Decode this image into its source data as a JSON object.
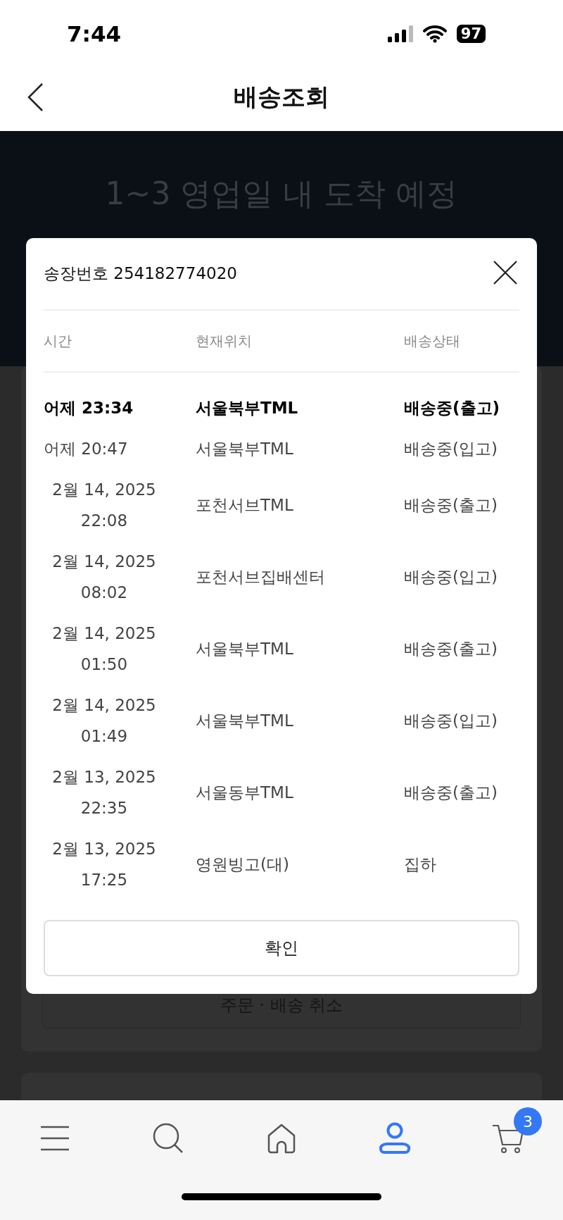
{
  "status_bar": {
    "time": "7:44",
    "battery": "97"
  },
  "header": {
    "title": "배송조회"
  },
  "banner": {
    "text": "1~3 영업일 내 도착 예정"
  },
  "background_button": {
    "label": "주문 · 배송 취소"
  },
  "modal": {
    "title": "송장번호 254182774020",
    "columns": [
      "시간",
      "현재위치",
      "배송상태"
    ],
    "rows": [
      {
        "time": "어제 23:34",
        "location": "서울북부TML",
        "status": "배송중(출고)",
        "current": true
      },
      {
        "time": "어제 20:47",
        "location": "서울북부TML",
        "status": "배송중(입고)",
        "current": false
      },
      {
        "time": "2월 14, 2025 22:08",
        "location": "포천서브TML",
        "status": "배송중(출고)",
        "current": false
      },
      {
        "time": "2월 14, 2025 08:02",
        "location": "포천서브집배센터",
        "status": "배송중(입고)",
        "current": false
      },
      {
        "time": "2월 14, 2025 01:50",
        "location": "서울북부TML",
        "status": "배송중(출고)",
        "current": false
      },
      {
        "time": "2월 14, 2025 01:49",
        "location": "서울북부TML",
        "status": "배송중(입고)",
        "current": false
      },
      {
        "time": "2월 13, 2025 22:35",
        "location": "서울동부TML",
        "status": "배송중(출고)",
        "current": false
      },
      {
        "time": "2월 13, 2025 17:25",
        "location": "영원빙고(대)",
        "status": "집하",
        "current": false
      }
    ],
    "confirm": "확인"
  },
  "tab_bar": {
    "items": [
      {
        "kind": "menu",
        "selected": false
      },
      {
        "kind": "search",
        "selected": false
      },
      {
        "kind": "home",
        "selected": false
      },
      {
        "kind": "profile",
        "selected": true
      },
      {
        "kind": "cart",
        "selected": false,
        "badge": "3"
      }
    ]
  }
}
